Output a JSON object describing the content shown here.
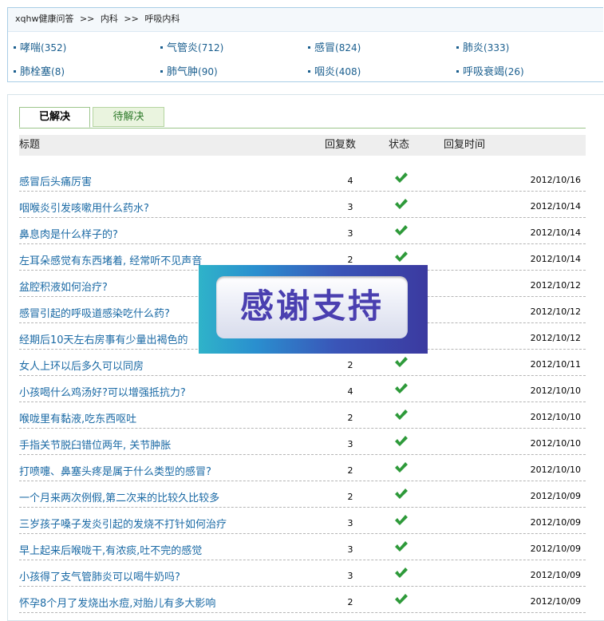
{
  "breadcrumb": {
    "site": "xqhw健康问答",
    "sep": ">>",
    "level1": "内科",
    "level2": "呼吸内科"
  },
  "categories": [
    {
      "label": "哮喘",
      "count": "(352)"
    },
    {
      "label": "气管炎",
      "count": "(712)"
    },
    {
      "label": "感冒",
      "count": "(824)"
    },
    {
      "label": "肺炎",
      "count": "(333)"
    },
    {
      "label": "肺栓塞",
      "count": "(8)"
    },
    {
      "label": "肺气肿",
      "count": "(90)"
    },
    {
      "label": "咽炎",
      "count": "(408)"
    },
    {
      "label": "呼吸衰竭",
      "count": "(26)"
    }
  ],
  "tabs": {
    "solved": "已解决",
    "pending": "待解决"
  },
  "table_header": {
    "title": "标题",
    "replies": "回复数",
    "status": "状态",
    "time": "回复时间"
  },
  "status_color": "#2e9a3a",
  "questions": [
    {
      "title": "感冒后头痛厉害",
      "replies": "4",
      "status": "check-icon",
      "date": "2012/10/16"
    },
    {
      "title": "咽喉炎引发咳嗽用什么药水?",
      "replies": "3",
      "status": "check-icon",
      "date": "2012/10/14"
    },
    {
      "title": "鼻息肉是什么样子的?",
      "replies": "3",
      "status": "check-icon",
      "date": "2012/10/14"
    },
    {
      "title": "左耳朵感觉有东西堵着, 经常听不见声音",
      "replies": "2",
      "status": "check-icon",
      "date": "2012/10/14"
    },
    {
      "title": "盆腔积液如何治疗?",
      "replies": "",
      "status": "",
      "date": "2012/10/12"
    },
    {
      "title": "感冒引起的呼吸道感染吃什么药?",
      "replies": "",
      "status": "",
      "date": "2012/10/12"
    },
    {
      "title": "经期后10天左右房事有少量出褐色的",
      "replies": "",
      "status": "",
      "date": "2012/10/12"
    },
    {
      "title": "女人上环以后多久可以同房",
      "replies": "2",
      "status": "check-icon",
      "date": "2012/10/11"
    },
    {
      "title": "小孩喝什么鸡汤好?可以增强抵抗力?",
      "replies": "4",
      "status": "check-icon",
      "date": "2012/10/10"
    },
    {
      "title": "喉咙里有黏液,吃东西呕吐",
      "replies": "2",
      "status": "check-icon",
      "date": "2012/10/10"
    },
    {
      "title": "手指关节脱臼错位两年, 关节肿胀",
      "replies": "3",
      "status": "check-icon",
      "date": "2012/10/10"
    },
    {
      "title": "打喷嚏、鼻塞头疼是属于什么类型的感冒?",
      "replies": "2",
      "status": "check-icon",
      "date": "2012/10/10"
    },
    {
      "title": "一个月来两次例假,第二次来的比较久比较多",
      "replies": "2",
      "status": "check-icon",
      "date": "2012/10/09"
    },
    {
      "title": "三岁孩子嗓子发炎引起的发烧不打针如何治疗",
      "replies": "3",
      "status": "check-icon",
      "date": "2012/10/09"
    },
    {
      "title": "早上起来后喉咙干,有浓痰,吐不完的感觉",
      "replies": "3",
      "status": "check-icon",
      "date": "2012/10/09"
    },
    {
      "title": "小孩得了支气管肺炎可以喝牛奶吗?",
      "replies": "3",
      "status": "check-icon",
      "date": "2012/10/09"
    },
    {
      "title": "怀孕8个月了发烧出水痘,对胎儿有多大影响",
      "replies": "2",
      "status": "check-icon",
      "date": "2012/10/09"
    }
  ],
  "banner": {
    "text": "感谢支持"
  }
}
